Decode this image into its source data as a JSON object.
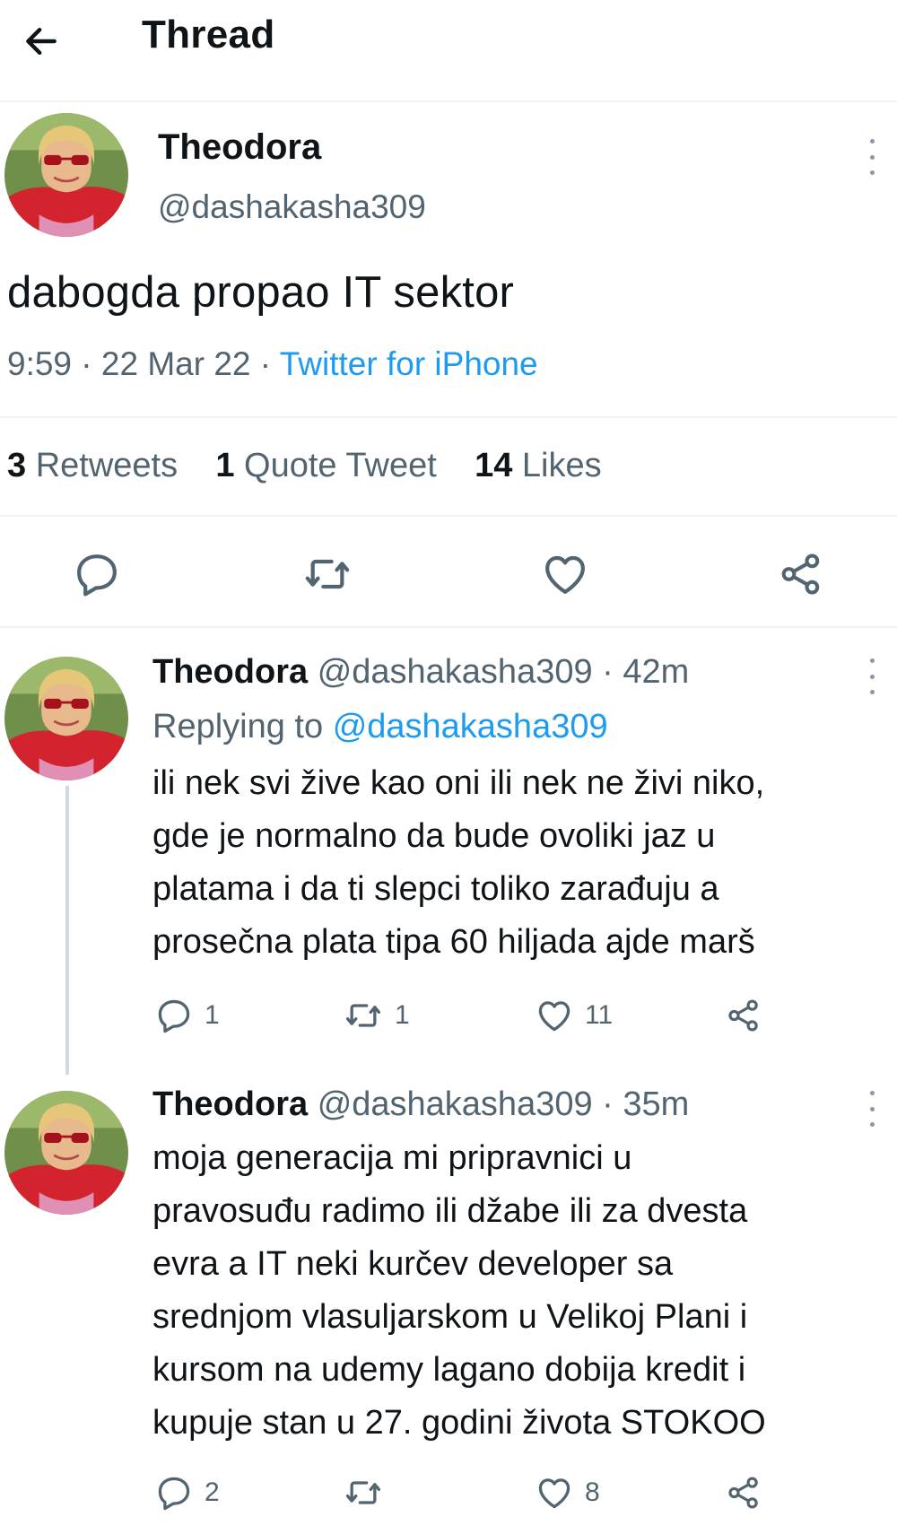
{
  "header": {
    "title": "Thread"
  },
  "main_tweet": {
    "name": "Theodora",
    "handle": "@dashakasha309",
    "text": "dabogda propao IT sektor",
    "time": "9:59",
    "date": "22 Mar 22",
    "source": "Twitter for iPhone",
    "retweets_count": "3",
    "retweets_label": "Retweets",
    "quotes_count": "1",
    "quotes_label": "Quote Tweet",
    "likes_count": "14",
    "likes_label": "Likes",
    "icons": [
      "reply-icon",
      "retweet-icon",
      "like-icon",
      "share-icon",
      "more-icon"
    ]
  },
  "replies": [
    {
      "name": "Theodora",
      "handle": "@dashakasha309",
      "time": "42m",
      "replying_prefix": "Replying to",
      "replying_to": "@dashakasha309",
      "lines": [
        "ili nek svi žive kao oni ili nek ne živi niko,",
        "gde je normalno da bude ovoliki jaz u",
        "platama i da ti slepci toliko zarađuju a",
        "prosečna plata tipa 60 hiljada ajde marš"
      ],
      "replies": "1",
      "retweets": "1",
      "likes": "11"
    },
    {
      "name": "Theodora",
      "handle": "@dashakasha309",
      "time": "35m",
      "lines": [
        "moja generacija mi pripravnici u",
        "pravosuđu radimo ili džabe ili za dvesta",
        "evra a IT neki kurčev developer sa",
        "srednjom vlasuljarskom u Velikoj Plani i",
        "kursom na udemy lagano dobija kredit i",
        "kupuje stan u 27. godini života STOKOO"
      ],
      "replies": "2",
      "retweets": "",
      "likes": "8"
    }
  ],
  "colors": {
    "text": "#0f1419",
    "muted": "#536471",
    "link": "#1d9bf0",
    "divider": "#eff3f4"
  }
}
